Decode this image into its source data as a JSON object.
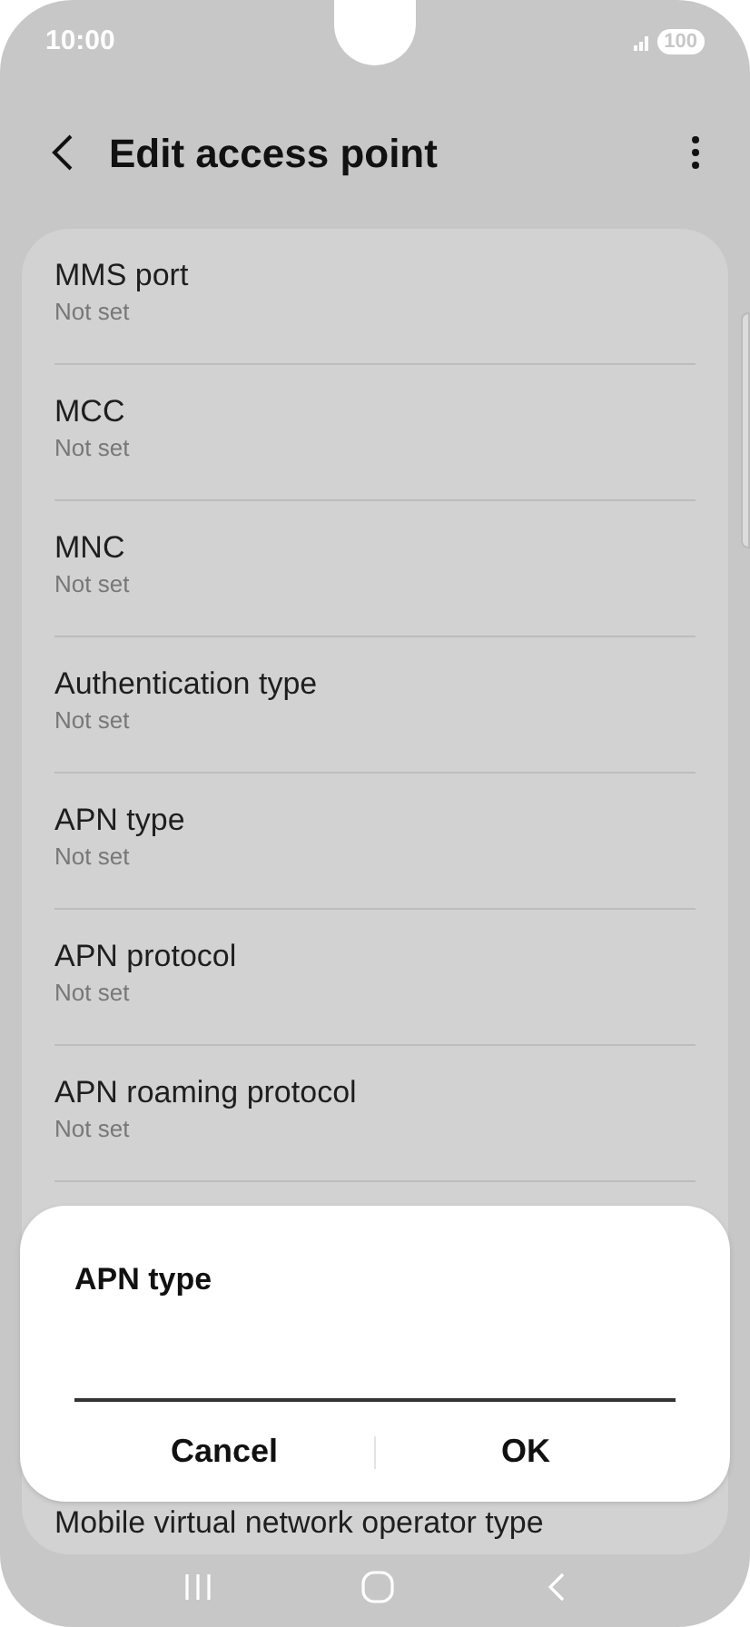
{
  "status_bar": {
    "time": "10:00",
    "battery": "100"
  },
  "header": {
    "title": "Edit access point"
  },
  "settings": [
    {
      "title": "MMS port",
      "value": "Not set"
    },
    {
      "title": "MCC",
      "value": "Not set"
    },
    {
      "title": "MNC",
      "value": "Not set"
    },
    {
      "title": "Authentication type",
      "value": "Not set"
    },
    {
      "title": "APN type",
      "value": "Not set"
    },
    {
      "title": "APN protocol",
      "value": "Not set"
    },
    {
      "title": "APN roaming protocol",
      "value": "Not set"
    },
    {
      "title": "Mobile virtual network operator type"
    }
  ],
  "dialog": {
    "title": "APN type",
    "buttons": [
      "Cancel",
      "OK"
    ]
  }
}
